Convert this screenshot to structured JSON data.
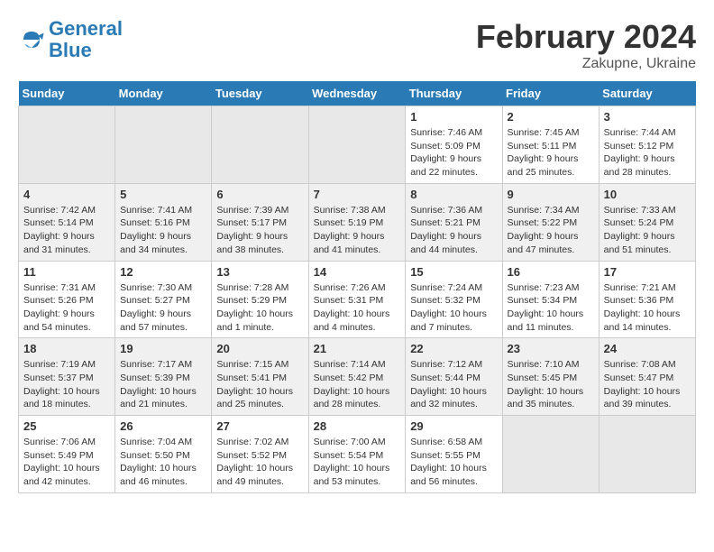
{
  "header": {
    "logo_line1": "General",
    "logo_line2": "Blue",
    "main_title": "February 2024",
    "subtitle": "Zakupne, Ukraine"
  },
  "columns": [
    "Sunday",
    "Monday",
    "Tuesday",
    "Wednesday",
    "Thursday",
    "Friday",
    "Saturday"
  ],
  "weeks": [
    [
      {
        "day": "",
        "empty": true
      },
      {
        "day": "",
        "empty": true
      },
      {
        "day": "",
        "empty": true
      },
      {
        "day": "",
        "empty": true
      },
      {
        "day": "1",
        "sunrise": "7:46 AM",
        "sunset": "5:09 PM",
        "daylight": "9 hours and 22 minutes."
      },
      {
        "day": "2",
        "sunrise": "7:45 AM",
        "sunset": "5:11 PM",
        "daylight": "9 hours and 25 minutes."
      },
      {
        "day": "3",
        "sunrise": "7:44 AM",
        "sunset": "5:12 PM",
        "daylight": "9 hours and 28 minutes."
      }
    ],
    [
      {
        "day": "4",
        "sunrise": "7:42 AM",
        "sunset": "5:14 PM",
        "daylight": "9 hours and 31 minutes."
      },
      {
        "day": "5",
        "sunrise": "7:41 AM",
        "sunset": "5:16 PM",
        "daylight": "9 hours and 34 minutes."
      },
      {
        "day": "6",
        "sunrise": "7:39 AM",
        "sunset": "5:17 PM",
        "daylight": "9 hours and 38 minutes."
      },
      {
        "day": "7",
        "sunrise": "7:38 AM",
        "sunset": "5:19 PM",
        "daylight": "9 hours and 41 minutes."
      },
      {
        "day": "8",
        "sunrise": "7:36 AM",
        "sunset": "5:21 PM",
        "daylight": "9 hours and 44 minutes."
      },
      {
        "day": "9",
        "sunrise": "7:34 AM",
        "sunset": "5:22 PM",
        "daylight": "9 hours and 47 minutes."
      },
      {
        "day": "10",
        "sunrise": "7:33 AM",
        "sunset": "5:24 PM",
        "daylight": "9 hours and 51 minutes."
      }
    ],
    [
      {
        "day": "11",
        "sunrise": "7:31 AM",
        "sunset": "5:26 PM",
        "daylight": "9 hours and 54 minutes."
      },
      {
        "day": "12",
        "sunrise": "7:30 AM",
        "sunset": "5:27 PM",
        "daylight": "9 hours and 57 minutes."
      },
      {
        "day": "13",
        "sunrise": "7:28 AM",
        "sunset": "5:29 PM",
        "daylight": "10 hours and 1 minute."
      },
      {
        "day": "14",
        "sunrise": "7:26 AM",
        "sunset": "5:31 PM",
        "daylight": "10 hours and 4 minutes."
      },
      {
        "day": "15",
        "sunrise": "7:24 AM",
        "sunset": "5:32 PM",
        "daylight": "10 hours and 7 minutes."
      },
      {
        "day": "16",
        "sunrise": "7:23 AM",
        "sunset": "5:34 PM",
        "daylight": "10 hours and 11 minutes."
      },
      {
        "day": "17",
        "sunrise": "7:21 AM",
        "sunset": "5:36 PM",
        "daylight": "10 hours and 14 minutes."
      }
    ],
    [
      {
        "day": "18",
        "sunrise": "7:19 AM",
        "sunset": "5:37 PM",
        "daylight": "10 hours and 18 minutes."
      },
      {
        "day": "19",
        "sunrise": "7:17 AM",
        "sunset": "5:39 PM",
        "daylight": "10 hours and 21 minutes."
      },
      {
        "day": "20",
        "sunrise": "7:15 AM",
        "sunset": "5:41 PM",
        "daylight": "10 hours and 25 minutes."
      },
      {
        "day": "21",
        "sunrise": "7:14 AM",
        "sunset": "5:42 PM",
        "daylight": "10 hours and 28 minutes."
      },
      {
        "day": "22",
        "sunrise": "7:12 AM",
        "sunset": "5:44 PM",
        "daylight": "10 hours and 32 minutes."
      },
      {
        "day": "23",
        "sunrise": "7:10 AM",
        "sunset": "5:45 PM",
        "daylight": "10 hours and 35 minutes."
      },
      {
        "day": "24",
        "sunrise": "7:08 AM",
        "sunset": "5:47 PM",
        "daylight": "10 hours and 39 minutes."
      }
    ],
    [
      {
        "day": "25",
        "sunrise": "7:06 AM",
        "sunset": "5:49 PM",
        "daylight": "10 hours and 42 minutes."
      },
      {
        "day": "26",
        "sunrise": "7:04 AM",
        "sunset": "5:50 PM",
        "daylight": "10 hours and 46 minutes."
      },
      {
        "day": "27",
        "sunrise": "7:02 AM",
        "sunset": "5:52 PM",
        "daylight": "10 hours and 49 minutes."
      },
      {
        "day": "28",
        "sunrise": "7:00 AM",
        "sunset": "5:54 PM",
        "daylight": "10 hours and 53 minutes."
      },
      {
        "day": "29",
        "sunrise": "6:58 AM",
        "sunset": "5:55 PM",
        "daylight": "10 hours and 56 minutes."
      },
      {
        "day": "",
        "empty": true
      },
      {
        "day": "",
        "empty": true
      }
    ]
  ]
}
